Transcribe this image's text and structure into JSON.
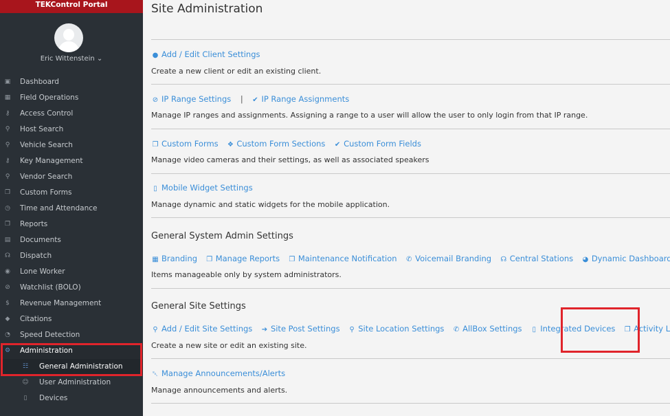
{
  "sidebar": {
    "brand": "TEKControl Portal",
    "user_name": "Eric Wittenstein ⌄",
    "items": [
      {
        "label": "Dashboard",
        "icon": "▣"
      },
      {
        "label": "Field Operations",
        "icon": "▦"
      },
      {
        "label": "Access Control",
        "icon": "⚷"
      },
      {
        "label": "Host Search",
        "icon": "⚲"
      },
      {
        "label": "Vehicle Search",
        "icon": "⚲"
      },
      {
        "label": "Key Management",
        "icon": "⚷"
      },
      {
        "label": "Vendor Search",
        "icon": "⚲"
      },
      {
        "label": "Custom Forms",
        "icon": "❐"
      },
      {
        "label": "Time and Attendance",
        "icon": "◷"
      },
      {
        "label": "Reports",
        "icon": "❐"
      },
      {
        "label": "Documents",
        "icon": "▤"
      },
      {
        "label": "Dispatch",
        "icon": "☊"
      },
      {
        "label": "Lone Worker",
        "icon": "◉"
      },
      {
        "label": "Watchlist (BOLO)",
        "icon": "⊘"
      },
      {
        "label": "Revenue Management",
        "icon": "$"
      },
      {
        "label": "Citations",
        "icon": "◆"
      },
      {
        "label": "Speed Detection",
        "icon": "◔"
      },
      {
        "label": "Administration",
        "icon": "⚙"
      }
    ],
    "subitems": [
      {
        "label": "General Administration",
        "icon": "☷"
      },
      {
        "label": "User Administration",
        "icon": "☺"
      },
      {
        "label": "Devices",
        "icon": "▯"
      }
    ]
  },
  "main": {
    "title": "Site Administration",
    "client": {
      "link": "Add / Edit Client Settings",
      "desc": "Create a new client or edit an existing client."
    },
    "ip": {
      "link1": "IP Range Settings",
      "sep": "|",
      "link2": "IP Range Assignments",
      "desc": "Manage IP ranges and assignments. Assigning a range to a user will allow the user to only login from that IP range."
    },
    "forms": {
      "link1": "Custom Forms",
      "link2": "Custom Form Sections",
      "link3": "Custom Form Fields",
      "desc": "Manage video cameras and their settings, as well as associated speakers"
    },
    "mobile": {
      "link": "Mobile Widget Settings",
      "desc": "Manage dynamic and static widgets for the mobile application."
    },
    "system": {
      "title": "General System Admin Settings",
      "links": [
        "Branding",
        "Manage Reports",
        "Maintenance Notification",
        "Voicemail Branding",
        "Central Stations",
        "Dynamic Dashboard Panels"
      ],
      "desc": "Items manageable only by system administrators."
    },
    "site": {
      "title": "General Site Settings",
      "links": [
        "Add / Edit Site Settings",
        "Site Post Settings",
        "Site Location Settings",
        "AllBox Settings",
        "Integrated Devices",
        "Activity Log"
      ],
      "desc": "Create a new site or edit an existing site."
    },
    "announcements": {
      "link": "Manage Announcements/Alerts",
      "desc": "Manage announcements and alerts."
    }
  }
}
